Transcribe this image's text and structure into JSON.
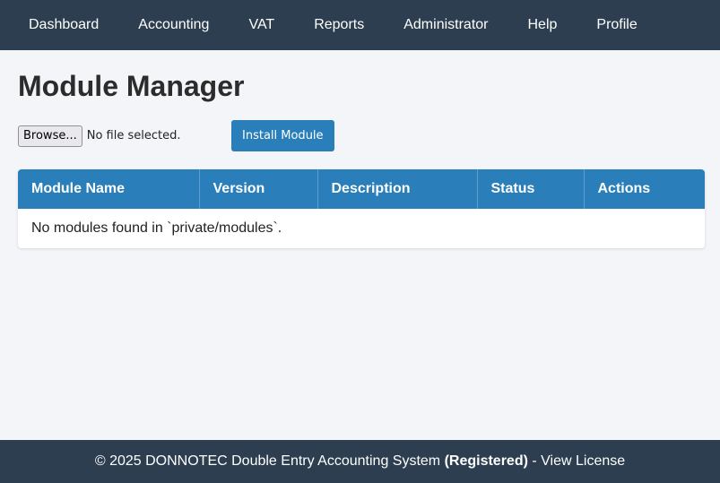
{
  "nav": {
    "items": [
      "Dashboard",
      "Accounting",
      "VAT",
      "Reports",
      "Administrator",
      "Help",
      "Profile"
    ]
  },
  "page": {
    "title": "Module Manager"
  },
  "upload": {
    "browse_label": "Browse...",
    "file_status": "No file selected.",
    "install_label": "Install Module"
  },
  "table": {
    "columns": [
      "Module Name",
      "Version",
      "Description",
      "Status",
      "Actions"
    ],
    "empty_message": "No modules found in `private/modules`."
  },
  "footer": {
    "copyright": "© 2025 DONNOTEC Double Entry Accounting System ",
    "registered": "(Registered)",
    "separator": " - ",
    "license_link": "View License"
  },
  "colors": {
    "navbar": "#2c3e50",
    "accent": "#2a7fba",
    "background": "#f4f5f9"
  }
}
